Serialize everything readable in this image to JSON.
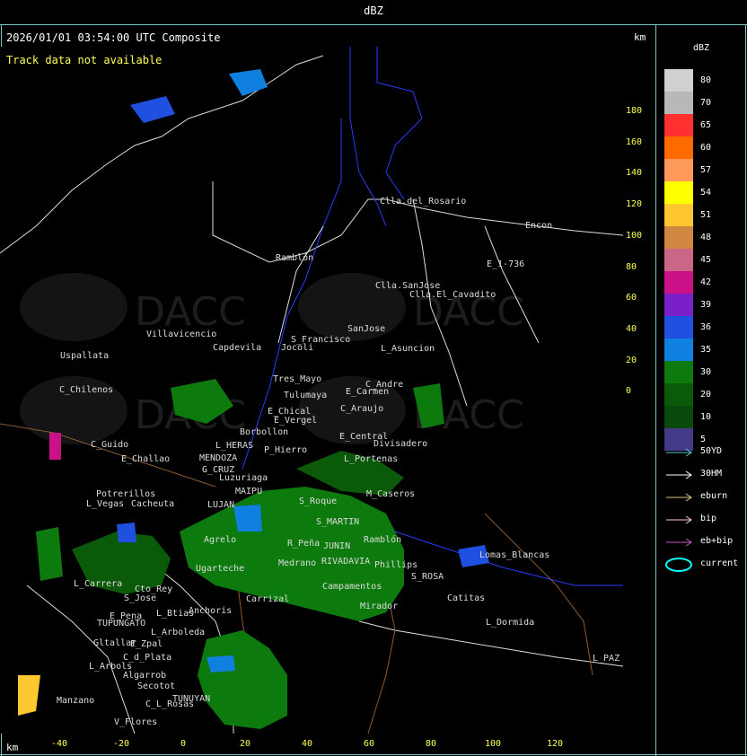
{
  "header": {
    "title": "dBZ"
  },
  "map": {
    "timestamp": "2026/01/01 03:54:00 UTC Composite",
    "notice": "Track data not available",
    "unit_top": "km",
    "unit_bottom": "km",
    "y_ticks": [
      "180",
      "160",
      "140",
      "120",
      "100",
      "80",
      "60",
      "40",
      "20",
      "0"
    ],
    "x_ticks": [
      "-40",
      "-20",
      "0",
      "20",
      "40",
      "60",
      "80",
      "100",
      "120"
    ],
    "watermark": "DACC",
    "places": [
      {
        "name": "Clla.del_Rosario"
      },
      {
        "name": "Encon"
      },
      {
        "name": "E_1-736"
      },
      {
        "name": "Ramblón"
      },
      {
        "name": "Clla.SanJose"
      },
      {
        "name": "Clla.El_Cavadito"
      },
      {
        "name": "SanJose"
      },
      {
        "name": "L_Asuncion"
      },
      {
        "name": "Villavicencio"
      },
      {
        "name": "Capdevila"
      },
      {
        "name": "S_Francisco"
      },
      {
        "name": "Uspallata"
      },
      {
        "name": "Jocoli"
      },
      {
        "name": "Tres_Mayo"
      },
      {
        "name": "C_Andre"
      },
      {
        "name": "C_Chilenos"
      },
      {
        "name": "Tulumaya"
      },
      {
        "name": "E_Carmen"
      },
      {
        "name": "E_Chical"
      },
      {
        "name": "C_Araujo"
      },
      {
        "name": "E_Vergel"
      },
      {
        "name": "Borbollon"
      },
      {
        "name": "E_Central"
      },
      {
        "name": "C_Guido"
      },
      {
        "name": "L_HERAS"
      },
      {
        "name": "P_Hierro"
      },
      {
        "name": "Divisadero"
      },
      {
        "name": "E_Challao"
      },
      {
        "name": "MENDOZA"
      },
      {
        "name": "L_Portenas"
      },
      {
        "name": "G_CRUZ"
      },
      {
        "name": "Luzuriaga"
      },
      {
        "name": "Potrerillos"
      },
      {
        "name": "MAIPU"
      },
      {
        "name": "L_Vegas"
      },
      {
        "name": "Cacheuta"
      },
      {
        "name": "LUJAN"
      },
      {
        "name": "S_Roque"
      },
      {
        "name": "M_Caseros"
      },
      {
        "name": "S_MARTIN"
      },
      {
        "name": "Agrelo"
      },
      {
        "name": "R_Peña"
      },
      {
        "name": "JUNIN"
      },
      {
        "name": "Ramblón"
      },
      {
        "name": "Ugarteche"
      },
      {
        "name": "RIVADAVIA"
      },
      {
        "name": "Medrano"
      },
      {
        "name": "Phillips"
      },
      {
        "name": "Lomas_Blancas"
      },
      {
        "name": "L_Carrera"
      },
      {
        "name": "Cto_Rey"
      },
      {
        "name": "Anchoris"
      },
      {
        "name": "S_ROSA"
      },
      {
        "name": "S_Jose"
      },
      {
        "name": "Carrizal"
      },
      {
        "name": "Campamentos"
      },
      {
        "name": "Catitas"
      },
      {
        "name": "E_Pena"
      },
      {
        "name": "L_Btias"
      },
      {
        "name": "TUPUNGATO"
      },
      {
        "name": "Mirador"
      },
      {
        "name": "L_Dormida"
      },
      {
        "name": "L_Arboleda"
      },
      {
        "name": "Gltallar"
      },
      {
        "name": "E_Zpal"
      },
      {
        "name": "L_PAZ"
      },
      {
        "name": "C_d_Plata"
      },
      {
        "name": "L_Arbols"
      },
      {
        "name": "Algarrob"
      },
      {
        "name": "Manzano"
      },
      {
        "name": "Secotot"
      },
      {
        "name": "TUNUYAN"
      },
      {
        "name": "C_L_Rosas"
      },
      {
        "name": "V_Flores"
      }
    ]
  },
  "legend": {
    "title": "dBZ",
    "scale": [
      {
        "label": "80",
        "color": "#d0d0d0"
      },
      {
        "label": "70",
        "color": "#b8b8b8"
      },
      {
        "label": "65",
        "color": "#ff3030"
      },
      {
        "label": "60",
        "color": "#ff6a00"
      },
      {
        "label": "57",
        "color": "#ff9a5a"
      },
      {
        "label": "54",
        "color": "#ffff00"
      },
      {
        "label": "51",
        "color": "#ffc830"
      },
      {
        "label": "48",
        "color": "#d08840"
      },
      {
        "label": "45",
        "color": "#cc6688"
      },
      {
        "label": "42",
        "color": "#cc1188"
      },
      {
        "label": "39",
        "color": "#7a20c8"
      },
      {
        "label": "36",
        "color": "#2050e0"
      },
      {
        "label": "35",
        "color": "#1080e0"
      },
      {
        "label": "30",
        "color": "#0c7a0c"
      },
      {
        "label": "20",
        "color": "#0a5a0a"
      },
      {
        "label": "10",
        "color": "#0a4a0a"
      },
      {
        "label": "5",
        "color": "#443a8a"
      }
    ],
    "tracks": [
      {
        "label": "50YD",
        "color": "#55cccc"
      },
      {
        "label": "30HM",
        "color": "#ffffff"
      },
      {
        "label": "eburn",
        "color": "#e0c880"
      },
      {
        "label": "bip",
        "color": "#ffcccc"
      },
      {
        "label": "eb+bip",
        "color": "#cc55cc"
      },
      {
        "label": "current",
        "color": "#00ffff"
      }
    ]
  }
}
